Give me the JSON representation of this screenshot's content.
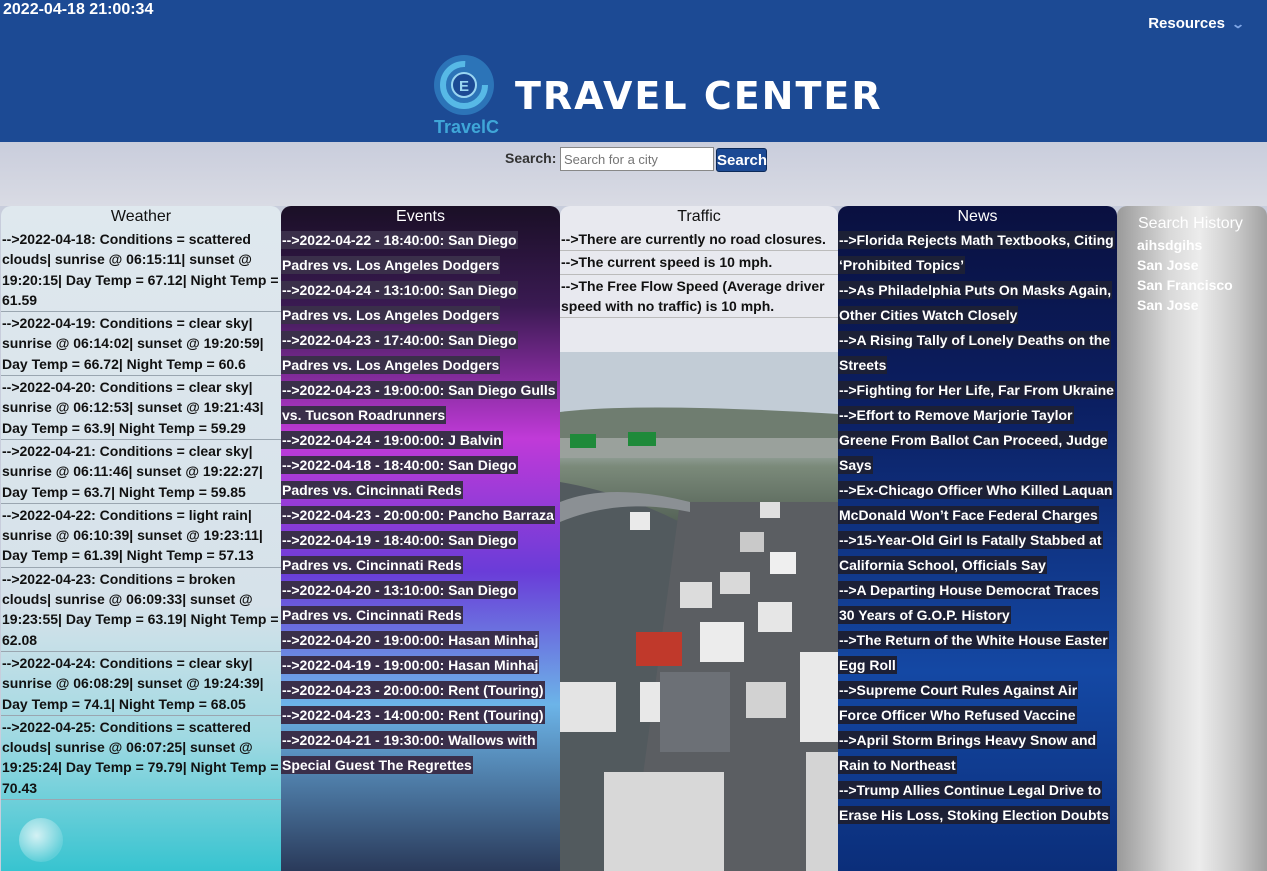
{
  "header": {
    "datetime": "2022-04-18 21:00:34",
    "resources_label": "Resources",
    "logo_letter": "E",
    "logo_text": "TravelC",
    "brand_title": "TRAVEL CENTER"
  },
  "search": {
    "label": "Search:",
    "placeholder": "Search for a city",
    "button_label": "Search"
  },
  "weather": {
    "title": "Weather",
    "items": [
      "-->2022-04-18: Conditions = scattered clouds| sunrise @ 06:15:11| sunset @ 19:20:15| Day Temp = 67.12| Night Temp = 61.59",
      "-->2022-04-19: Conditions = clear sky| sunrise @ 06:14:02| sunset @ 19:20:59| Day Temp = 66.72| Night Temp = 60.6",
      "-->2022-04-20: Conditions = clear sky| sunrise @ 06:12:53| sunset @ 19:21:43| Day Temp = 63.9| Night Temp = 59.29",
      "-->2022-04-21: Conditions = clear sky| sunrise @ 06:11:46| sunset @ 19:22:27| Day Temp = 63.7| Night Temp = 59.85",
      "-->2022-04-22: Conditions = light rain| sunrise @ 06:10:39| sunset @ 19:23:11| Day Temp = 61.39| Night Temp = 57.13",
      "-->2022-04-23: Conditions = broken clouds| sunrise @ 06:09:33| sunset @ 19:23:55| Day Temp = 63.19| Night Temp = 62.08",
      "-->2022-04-24: Conditions = clear sky| sunrise @ 06:08:29| sunset @ 19:24:39| Day Temp = 74.1| Night Temp = 68.05",
      "-->2022-04-25: Conditions = scattered clouds| sunrise @ 06:07:25| sunset @ 19:25:24| Day Temp = 79.79| Night Temp = 70.43"
    ]
  },
  "events": {
    "title": "Events",
    "items": [
      "-->2022-04-22 - 18:40:00: San Diego Padres vs. Los Angeles Dodgers",
      "-->2022-04-24 - 13:10:00: San Diego Padres vs. Los Angeles Dodgers",
      "-->2022-04-23 - 17:40:00: San Diego Padres vs. Los Angeles Dodgers",
      "-->2022-04-23 - 19:00:00: San Diego Gulls vs. Tucson Roadrunners",
      "-->2022-04-24 - 19:00:00: J Balvin",
      "-->2022-04-18 - 18:40:00: San Diego Padres vs. Cincinnati Reds",
      "-->2022-04-23 - 20:00:00: Pancho Barraza",
      "-->2022-04-19 - 18:40:00: San Diego Padres vs. Cincinnati Reds",
      "-->2022-04-20 - 13:10:00: San Diego Padres vs. Cincinnati Reds",
      "-->2022-04-20 - 19:00:00: Hasan Minhaj",
      "-->2022-04-19 - 19:00:00: Hasan Minhaj",
      "-->2022-04-23 - 20:00:00: Rent (Touring)",
      "-->2022-04-23 - 14:00:00: Rent (Touring)",
      "-->2022-04-21 - 19:30:00: Wallows with Special Guest The Regrettes"
    ]
  },
  "traffic": {
    "title": "Traffic",
    "items": [
      "-->There are currently no road closures.",
      "-->The current speed is 10 mph.",
      "-->The Free Flow Speed (Average driver speed with no traffic) is 10 mph."
    ]
  },
  "news": {
    "title": "News",
    "items": [
      "-->Florida Rejects Math Textbooks, Citing ‘Prohibited Topics’",
      "-->As Philadelphia Puts On Masks Again, Other Cities Watch Closely",
      "-->A Rising Tally of Lonely Deaths on the Streets",
      "-->Fighting for Her Life, Far From Ukraine",
      "-->Effort to Remove Marjorie Taylor Greene From Ballot Can Proceed, Judge Says",
      "-->Ex-Chicago Officer Who Killed Laquan McDonald Won’t Face Federal Charges",
      "-->15-Year-Old Girl Is Fatally Stabbed at California School, Officials Say",
      "-->A Departing House Democrat Traces 30 Years of G.O.P. History",
      "-->The Return of the White House Easter Egg Roll",
      "-->Supreme Court Rules Against Air Force Officer Who Refused Vaccine",
      "-->April Storm Brings Heavy Snow and Rain to Northeast",
      "-->Trump Allies Continue Legal Drive to Erase His Loss, Stoking Election Doubts"
    ]
  },
  "history": {
    "title": "Search History",
    "items": [
      "aihsdgihs",
      "San Jose",
      "San Francisco",
      "San Jose"
    ]
  },
  "colors": {
    "header_bg": "#1c4a94",
    "highlight_bg": "#3a2f4a",
    "logo_accent": "#3fa6d8"
  },
  "icons": {
    "resources_chevron": "chevron-down-icon",
    "logo": "travelc-logo-icon"
  }
}
